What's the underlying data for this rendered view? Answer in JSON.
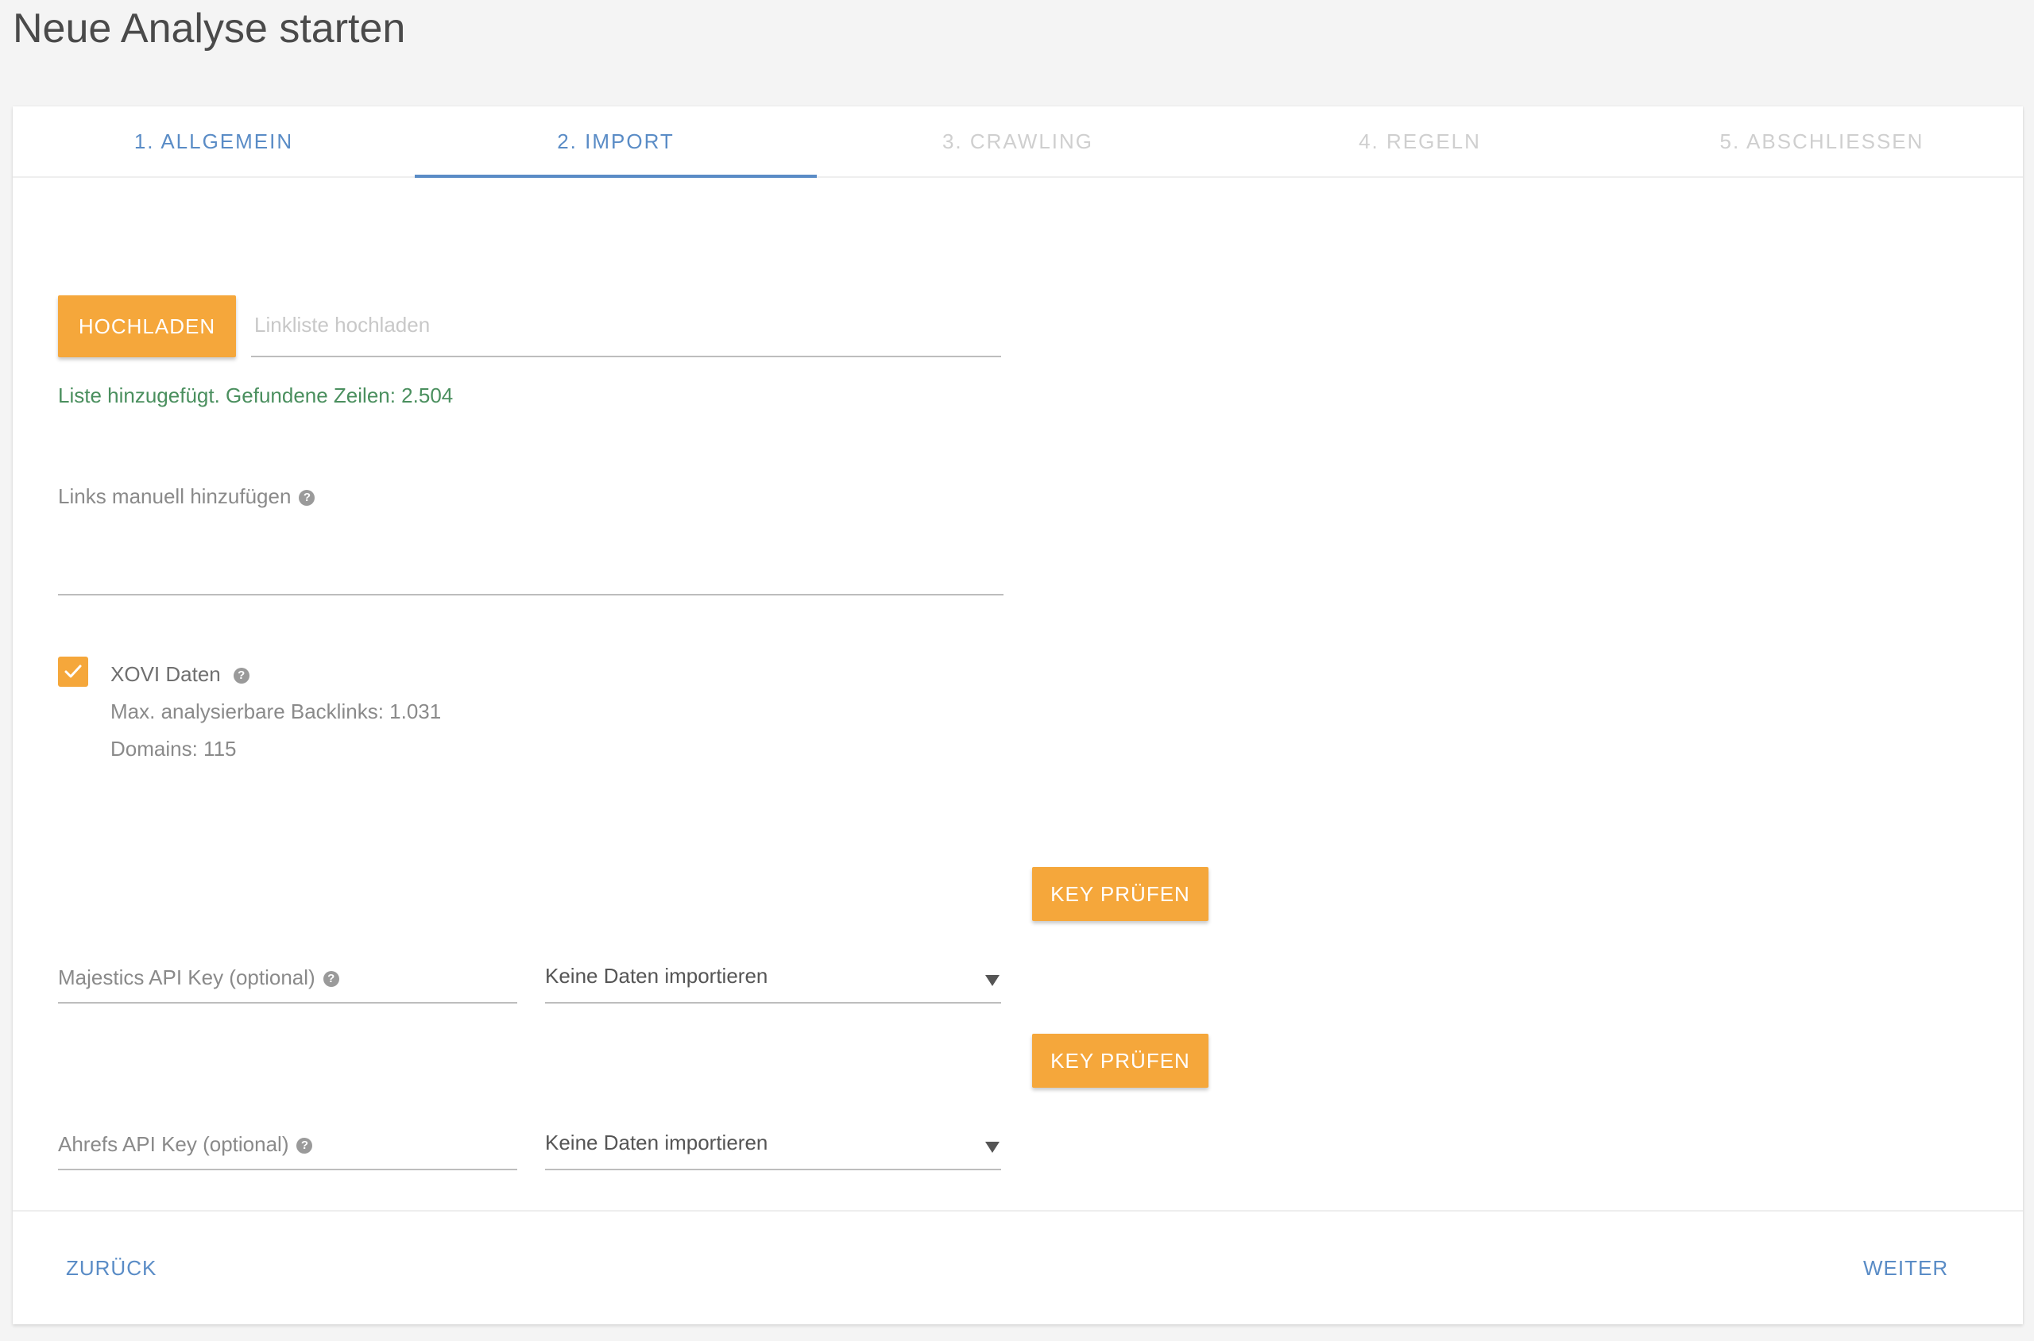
{
  "page": {
    "title": "Neue Analyse starten"
  },
  "tabs": [
    {
      "label": "1. Allgemein",
      "state": "done"
    },
    {
      "label": "2. Import",
      "state": "active"
    },
    {
      "label": "3. Crawling",
      "state": "disabled"
    },
    {
      "label": "4. Regeln",
      "state": "disabled"
    },
    {
      "label": "5. Abschliessen",
      "state": "disabled"
    }
  ],
  "upload": {
    "button_label": "Hochladen",
    "placeholder": "Linkliste hochladen",
    "status": "Liste hinzugefügt. Gefundene Zeilen: 2.504"
  },
  "manual_links": {
    "label": "Links manuell hinzufügen",
    "value": ""
  },
  "xovi": {
    "checked": true,
    "label": "XOVI Daten",
    "max_backlinks": "Max. analysierbare Backlinks: 1.031",
    "domains": "Domains: 115"
  },
  "majestics": {
    "label": "Majestics API Key (optional)",
    "select_value": "Keine Daten importieren",
    "button_label": "Key prüfen"
  },
  "ahrefs": {
    "label": "Ahrefs API Key (optional)",
    "select_value": "Keine Daten importieren",
    "button_label": "Key prüfen"
  },
  "footer": {
    "back_label": "Zurück",
    "next_label": "Weiter"
  },
  "colors": {
    "accent_orange": "#f5a73b",
    "accent_blue": "#5a8cc6",
    "success_green": "#4a8f5e"
  }
}
